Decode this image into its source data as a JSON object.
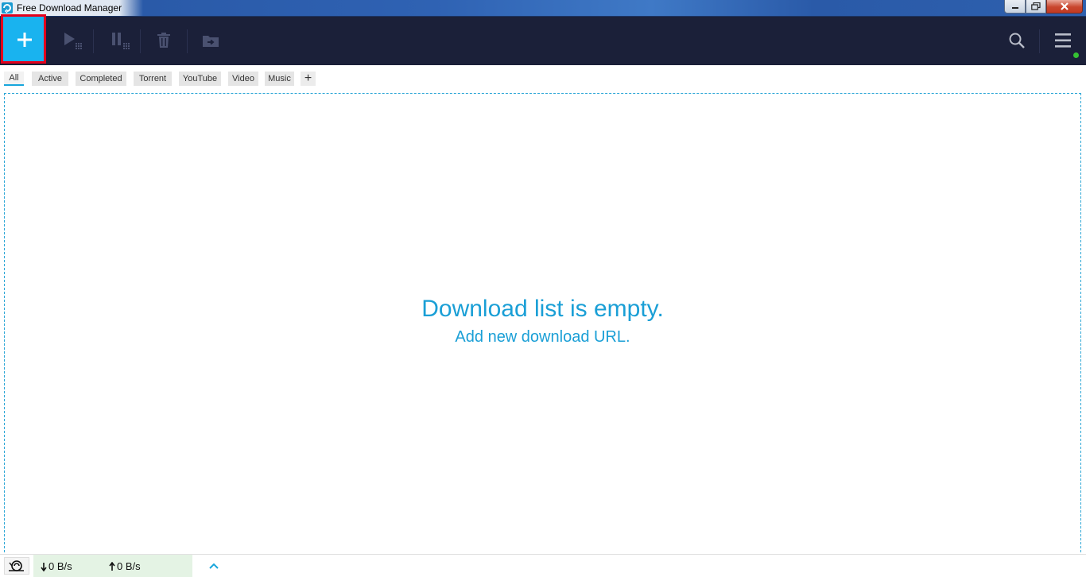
{
  "window": {
    "title": "Free Download Manager"
  },
  "toolbar": {
    "add_icon": "plus-icon",
    "start_icon": "play-icon",
    "pause_icon": "pause-icon",
    "delete_icon": "trash-icon",
    "move_icon": "folder-move-icon",
    "search_icon": "search-icon",
    "menu_icon": "hamburger-menu-icon",
    "accent": "#19b3ef",
    "background": "#1b2039",
    "highlight_color": "#e3001b",
    "status_dot_color": "#35c233"
  },
  "tabs": [
    {
      "label": "All",
      "active": true
    },
    {
      "label": "Active"
    },
    {
      "label": "Completed"
    },
    {
      "label": "Torrent"
    },
    {
      "label": "YouTube"
    },
    {
      "label": "Video"
    },
    {
      "label": "Music"
    },
    {
      "label": "+"
    }
  ],
  "main": {
    "empty_title": "Download list is empty.",
    "empty_subtitle": "Add new download URL.",
    "text_color": "#1a9fd6"
  },
  "statusbar": {
    "snail_icon": "snail-mode-icon",
    "download_speed": "0 B/s",
    "upload_speed": "0 B/s",
    "expand_icon": "chevron-up-icon"
  }
}
